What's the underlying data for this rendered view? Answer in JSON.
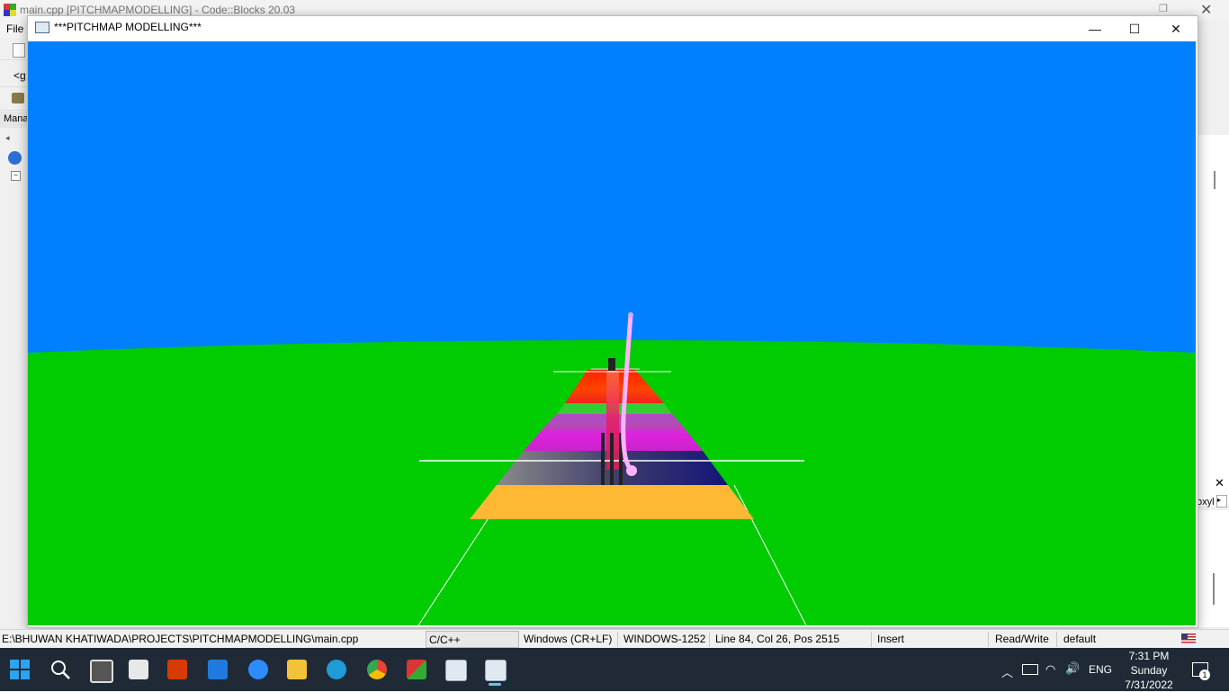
{
  "ide": {
    "title": "main.cpp [PITCHMAPMODELLING] - Code::Blocks 20.03",
    "menu_file": "File",
    "left_toolbar_text": "<g",
    "management_label": "Mana",
    "right_panel_text": "oxyl"
  },
  "glwindow": {
    "title": "***PITCHMAP MODELLING***",
    "minimize": "—",
    "maximize": "☐",
    "close": "✕"
  },
  "scene": {
    "sky_color": "#0080ff",
    "ground_color": "#00cc00",
    "pitch_bands": [
      {
        "name": "orange-band",
        "color": "#ffb833"
      },
      {
        "name": "navy-band",
        "color": "#14147a"
      },
      {
        "name": "purple-band",
        "color": "#cc22cc"
      },
      {
        "name": "green-band",
        "color": "#33cc33"
      },
      {
        "name": "red-band",
        "color": "#ff3300"
      }
    ],
    "ball_color": "#ffb3ff"
  },
  "statusbar": {
    "path": "E:\\BHUWAN KHATIWADA\\PROJECTS\\PITCHMAPMODELLING\\main.cpp",
    "language": "C/C++",
    "line_endings": "Windows (CR+LF)",
    "encoding": "WINDOWS-1252",
    "position": "Line 84, Col 26, Pos 2515",
    "mode": "Insert",
    "access": "Read/Write",
    "profile": "default"
  },
  "taskbar": {
    "lang": "ENG",
    "time": "7:31 PM",
    "day": "Sunday",
    "date": "7/31/2022",
    "notification_count": "1"
  }
}
